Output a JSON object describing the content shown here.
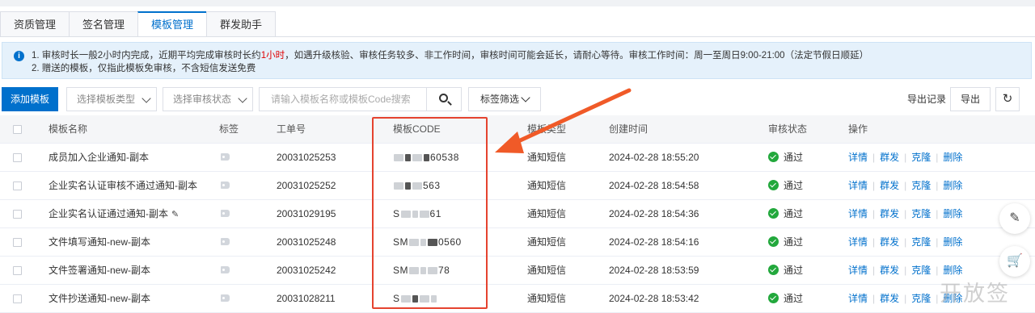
{
  "tabs": [
    "资质管理",
    "签名管理",
    "模板管理",
    "群发助手"
  ],
  "active_tab": 2,
  "notice": {
    "line1_a": "1. 审核时长一般2小时内完成，近期平均完成审核时长约",
    "line1_red": "1小时",
    "line1_b": "，如遇升级核验、审核任务较多、非工作时间，审核时间可能会延长，请耐心等待。审核工作时间：周一至周日9:00-21:00（法定节假日顺延）",
    "line2": "2. 赠送的模板，仅指此模板免审核，不含短信发送免费"
  },
  "toolbar": {
    "add_template": "添加模板",
    "type_placeholder": "选择模板类型",
    "status_placeholder": "选择审核状态",
    "search_placeholder": "请输入模板名称或模板Code搜索",
    "tag_filter": "标签筛选",
    "export_log": "导出记录",
    "export": "导出"
  },
  "columns": {
    "name": "模板名称",
    "tag": "标签",
    "ticket": "工单号",
    "code": "模板CODE",
    "type": "模板类型",
    "created": "创建时间",
    "status": "审核状态",
    "ops": "操作"
  },
  "actions": [
    "详情",
    "群发",
    "克隆",
    "删除"
  ],
  "rows": [
    {
      "name": "成员加入企业通知-副本",
      "ticket": "20031025253",
      "code_prefix": "",
      "code_suffix": "60538",
      "type": "通知短信",
      "created": "2024-02-28 18:55:20",
      "status": "通过",
      "editable": false
    },
    {
      "name": "企业实名认证审核不通过通知-副本",
      "ticket": "20031025252",
      "code_prefix": "",
      "code_suffix": "563",
      "type": "通知短信",
      "created": "2024-02-28 18:54:58",
      "status": "通过",
      "editable": false
    },
    {
      "name": "企业实名认证通过通知-副本",
      "ticket": "20031029195",
      "code_prefix": "S",
      "code_suffix": "61",
      "type": "通知短信",
      "created": "2024-02-28 18:54:36",
      "status": "通过",
      "editable": true
    },
    {
      "name": "文件填写通知-new-副本",
      "ticket": "20031025248",
      "code_prefix": "SM",
      "code_suffix": "0560",
      "type": "通知短信",
      "created": "2024-02-28 18:54:16",
      "status": "通过",
      "editable": false
    },
    {
      "name": "文件签署通知-new-副本",
      "ticket": "20031025242",
      "code_prefix": "SM",
      "code_suffix": "78",
      "type": "通知短信",
      "created": "2024-02-28 18:53:59",
      "status": "通过",
      "editable": false
    },
    {
      "name": "文件抄送通知-new-副本",
      "ticket": "20031028211",
      "code_prefix": "S",
      "code_suffix": "",
      "type": "通知短信",
      "created": "2024-02-28 18:53:42",
      "status": "通过",
      "editable": false
    }
  ],
  "watermark": "开放签",
  "colors": {
    "primary": "#0070cc",
    "success": "#22a83c",
    "highlight": "#e5432f",
    "notice_bg": "#e5f1fb"
  }
}
